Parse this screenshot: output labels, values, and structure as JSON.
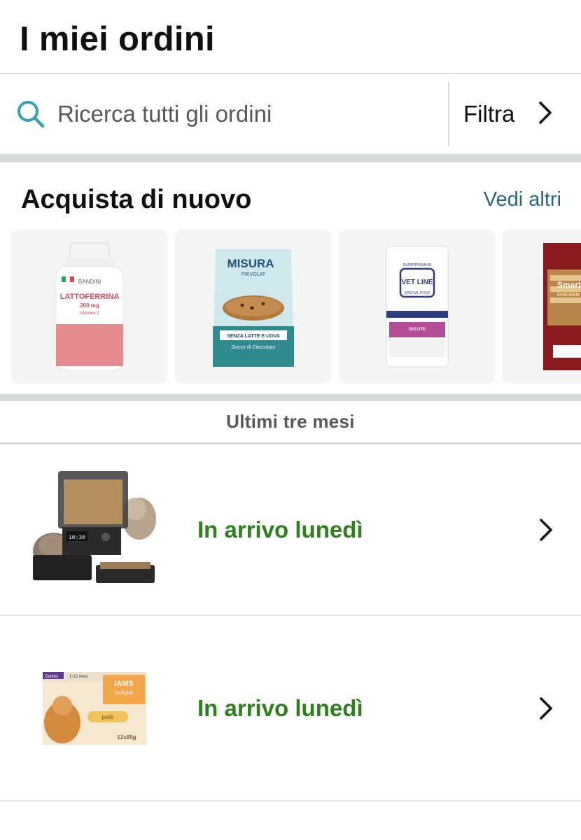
{
  "header": {
    "title": "I miei ordini"
  },
  "search": {
    "placeholder": "Ricerca tutti gli ordini",
    "filter_label": "Filtra"
  },
  "buy_again": {
    "title": "Acquista di nuovo",
    "see_more": "Vedi altri",
    "products": [
      {
        "name": "lattoferrina-bottle",
        "brand": "BANDINI",
        "label": "LATTOFERRINA",
        "dose": "200 mg",
        "sub": "Vitamina C"
      },
      {
        "name": "misura-biscuits",
        "brand": "MISURA",
        "label": "PRIVOLAT",
        "tagline": "SENZA LATTE E UOVA",
        "sub": "Gocce di Cioccolato"
      },
      {
        "name": "vetline-food",
        "brand": "VET LINE",
        "label": "SPECIAL FOOD",
        "tagline": "SALUTE"
      },
      {
        "name": "smart-chicken-treats",
        "brand": "Smart",
        "label": "CHICKEN"
      }
    ]
  },
  "period": {
    "label": "Ultimi tre mesi"
  },
  "orders": [
    {
      "status": "In arrivo lunedì",
      "item": "cat-food-dispenser",
      "screen": "10:30"
    },
    {
      "status": "In arrivo lunedì",
      "item": "iams-delights-box",
      "brand": "IAMS",
      "sub": "Delights",
      "flavor": "pollo",
      "age": "1-12 mesi",
      "kitten": "Gattino",
      "weight": "12x85g"
    }
  ],
  "colors": {
    "accent_link": "#2a6678",
    "status_green": "#2f7f1f",
    "divider": "#d5d9d9",
    "search_icon": "#3aa0b0"
  }
}
